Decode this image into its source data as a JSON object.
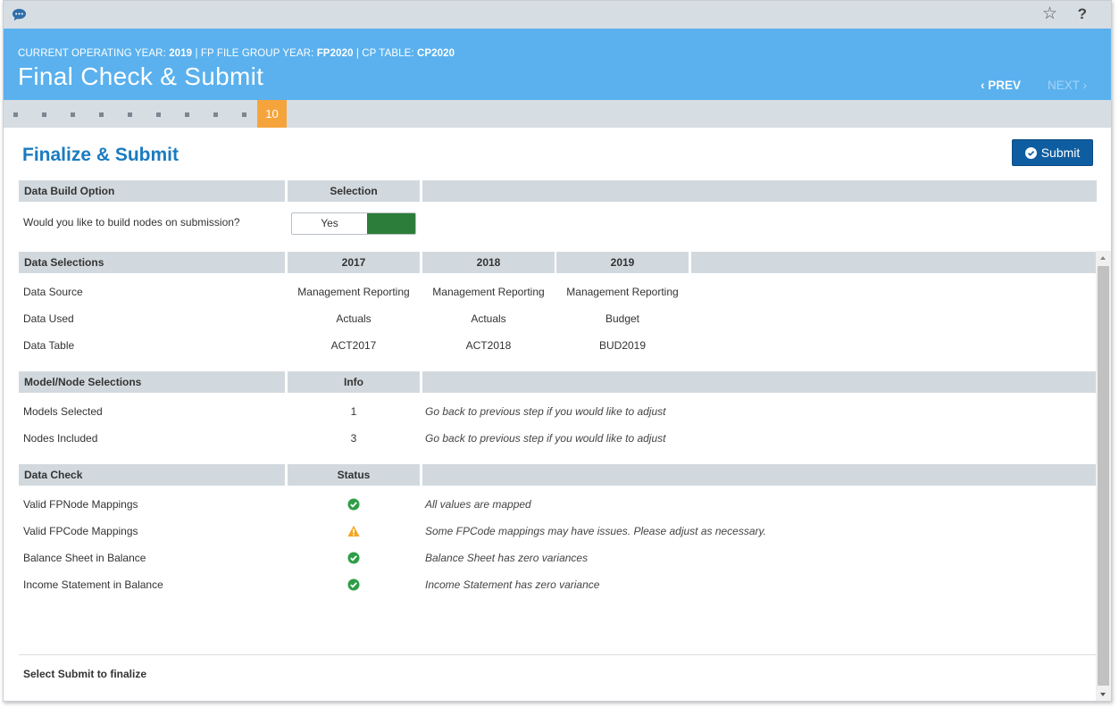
{
  "header": {
    "context_prefix_year": "CURRENT OPERATING YEAR:",
    "operating_year": "2019",
    "context_prefix_fp": "| FP FILE GROUP YEAR:",
    "fp_year": "FP2020",
    "context_prefix_cp": "| CP TABLE:",
    "cp_table": "CP2020",
    "title": "Final Check & Submit",
    "prev_label": "PREV",
    "next_label": "NEXT"
  },
  "steps": {
    "current": "10"
  },
  "section": {
    "title": "Finalize & Submit",
    "submit_label": "Submit"
  },
  "build_option": {
    "col1": "Data Build Option",
    "col2": "Selection",
    "question": "Would you like to build nodes on submission?",
    "toggle_label": "Yes"
  },
  "data_selections": {
    "col1": "Data Selections",
    "years": [
      "2017",
      "2018",
      "2019"
    ],
    "rows": [
      {
        "label": "Data Source",
        "values": [
          "Management Reporting",
          "Management Reporting",
          "Management Reporting"
        ]
      },
      {
        "label": "Data Used",
        "values": [
          "Actuals",
          "Actuals",
          "Budget"
        ]
      },
      {
        "label": "Data Table",
        "values": [
          "ACT2017",
          "ACT2018",
          "BUD2019"
        ]
      }
    ]
  },
  "model_node": {
    "col1": "Model/Node Selections",
    "col2": "Info",
    "rows": [
      {
        "label": "Models Selected",
        "value": "1",
        "info": "Go back to previous step if you would like to adjust"
      },
      {
        "label": "Nodes Included",
        "value": "3",
        "info": "Go back to previous step if you would like to adjust"
      }
    ]
  },
  "data_check": {
    "col1": "Data Check",
    "col2": "Status",
    "rows": [
      {
        "label": "Valid FPNode Mappings",
        "status": "ok",
        "info": "All values are mapped"
      },
      {
        "label": "Valid FPCode Mappings",
        "status": "warning",
        "info": "Some FPCode mappings may have issues. Please adjust as necessary."
      },
      {
        "label": "Balance Sheet in Balance",
        "status": "ok",
        "info": "Balance Sheet has zero variances"
      },
      {
        "label": "Income Statement in Balance",
        "status": "ok",
        "info": "Income Statement has zero variance"
      }
    ]
  },
  "footer": {
    "text": "Select Submit to finalize"
  },
  "colors": {
    "header_bg": "#5ab1ee",
    "accent_blue": "#1a7bbf",
    "submit_bg": "#0e5da0",
    "step_current": "#f5a43c",
    "ok_green": "#2e9e46",
    "warning_orange": "#f5a623",
    "toggle_green": "#2d7d3a"
  }
}
